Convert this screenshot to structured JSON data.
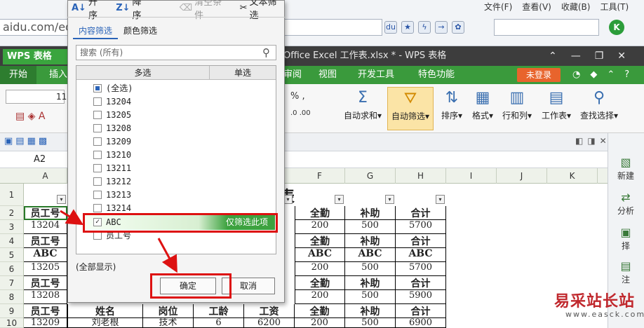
{
  "browser": {
    "menu": [
      "文件(F)",
      "查看(V)",
      "收藏(B)",
      "工具(T)"
    ],
    "url": "aidu.com/edi"
  },
  "wps": {
    "logo": "WPS 表格",
    "doc_title": "Office Excel 工作表.xlsx * - WPS 表格",
    "tabs": [
      "开始",
      "插入",
      "审阅",
      "视图",
      "开发工具",
      "特色功能"
    ],
    "login": "未登录",
    "ribbon": {
      "autosum": "自动求和",
      "autofilter": "自动筛选",
      "sort": "排序",
      "format": "格式",
      "rowcol": "行和列",
      "worksheet": "工作表",
      "findselect": "查找选择"
    },
    "font_size": "11",
    "cell_ref": "A2"
  },
  "sheet": {
    "col_headers": [
      "A",
      "F",
      "G",
      "H",
      "I",
      "J",
      "K"
    ],
    "row_numbers": [
      "1",
      "2",
      "3",
      "4",
      "5",
      "6",
      "7",
      "8",
      "9",
      "10"
    ],
    "title_fragment": "表",
    "col_a": [
      "员工号",
      "13204",
      "员工号",
      "ABC",
      "13205",
      "员工号",
      "13208",
      "员工号",
      "13209"
    ],
    "col_f": [
      "全勤",
      "200",
      "全勤",
      "ABC",
      "200",
      "全勤",
      "200",
      "全勤",
      "200"
    ],
    "col_g": [
      "补助",
      "500",
      "补助",
      "ABC",
      "500",
      "补助",
      "500",
      "补助",
      "500"
    ],
    "col_h": [
      "合计",
      "5700",
      "合计",
      "ABC",
      "5700",
      "合计",
      "5900",
      "合计",
      "6900"
    ],
    "row9_mid": [
      "姓名",
      "岗位",
      "工龄",
      "工资"
    ],
    "row10_mid": [
      "刘老根",
      "技术",
      "6",
      "6200"
    ]
  },
  "right_panel": [
    "新建",
    "分析",
    "择",
    "注"
  ],
  "watermark": {
    "cn": "易采站长站",
    "url": "www.easck.com"
  },
  "filter_dialog": {
    "sort_asc": "升序",
    "sort_desc": "降序",
    "clear": "清空条件",
    "text_filter": "文本筛选",
    "tab_content": "内容筛选",
    "tab_color": "颜色筛选",
    "search_placeholder": "搜索 (所有)",
    "list_header_multi": "多选",
    "list_header_single": "单选",
    "items": [
      "(全选)",
      "13204",
      "13205",
      "13208",
      "13209",
      "13210",
      "13211",
      "13212",
      "13213",
      "13214",
      "ABC",
      "员工号"
    ],
    "only_this": "仅筛选此项",
    "show_all": "(全部显示)",
    "ok": "确定",
    "cancel": "取消"
  },
  "colors": {
    "wps_green": "#3a9a3c",
    "annotation_red": "#dd1111",
    "login_orange": "#e8642c"
  }
}
